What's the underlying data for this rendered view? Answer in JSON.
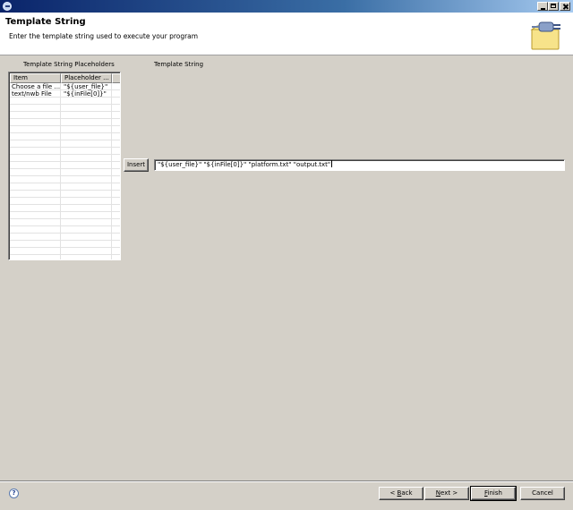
{
  "window": {
    "title": "",
    "controls": [
      "minimize-icon",
      "maximize-icon",
      "close-icon"
    ]
  },
  "header": {
    "title": "Template String",
    "description": "Enter the template string used to execute your program",
    "banner_icon": "wizard-plug-folder-icon"
  },
  "placeholders": {
    "label": "Template String Placeholders",
    "columns": [
      "Item",
      "Placeholder ..."
    ],
    "rows": [
      {
        "item": "Choose a file ...",
        "placeholder": "\"${user_file}\""
      },
      {
        "item": "text/nwb File",
        "placeholder": "\"${inFile[0]}\""
      }
    ]
  },
  "template": {
    "label": "Template String",
    "value": "\"${user_file}\" \"${inFile[0]}\" \"platform.txt\" \"output.txt\"",
    "insert_label": "Insert"
  },
  "footer": {
    "help_icon": "help-icon",
    "back_pre": "< ",
    "back_accel": "B",
    "back_post": "ack",
    "next_accel": "N",
    "next_post": "ext >",
    "finish_accel": "F",
    "finish_post": "inish",
    "cancel_label": "Cancel"
  },
  "colors": {
    "dialog_bg": "#d4d0c8",
    "header_bg": "#ffffff",
    "titlebar_start": "#0a246a",
    "titlebar_end": "#a6caf0"
  }
}
